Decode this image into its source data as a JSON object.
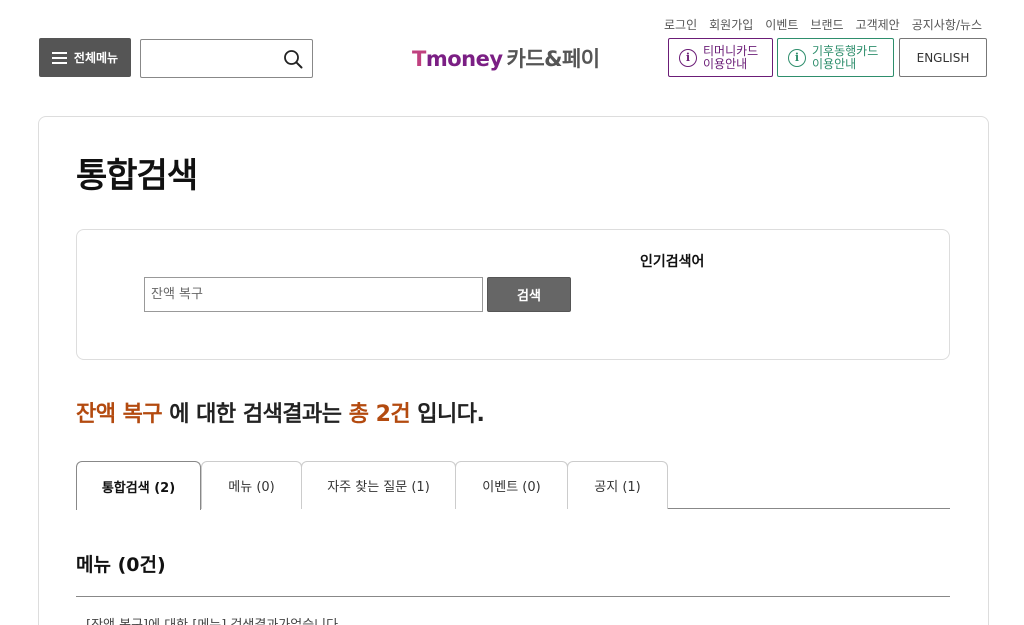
{
  "util_nav": [
    "로그인",
    "회원가입",
    "이벤트",
    "브랜드",
    "고객제안",
    "공지사항/뉴스"
  ],
  "header": {
    "menu_label": "전체메뉴",
    "search_placeholder": "",
    "logo_brand": "money",
    "logo_brand_t": "T",
    "logo_suffix": "카드&페이",
    "guide_tmoney_line1": "티머니카드",
    "guide_tmoney_line2": "이용안내",
    "guide_climate_line1": "기후동행카드",
    "guide_climate_line2": "이용안내",
    "english_label": "ENGLISH"
  },
  "page": {
    "title": "통합검색",
    "search_value": "",
    "search_placeholder": "잔액 복구",
    "search_button": "검색",
    "popular_title": "인기검색어"
  },
  "result": {
    "keyword": "잔액 복구",
    "middle_text": " 에 대한 검색결과는 ",
    "count_text": "총 2건",
    "end_text": " 입니다."
  },
  "tabs": [
    {
      "label": "통합검색 (2)",
      "active": true
    },
    {
      "label": "메뉴 (0)",
      "active": false
    },
    {
      "label": "자주 찾는 질문 (1)",
      "active": false
    },
    {
      "label": "이벤트 (0)",
      "active": false
    },
    {
      "label": "공지 (1)",
      "active": false
    }
  ],
  "menu_section": {
    "title": "메뉴 (0건)",
    "empty_message": "[잔액 복구]에 대한 [메뉴] 검색결과가없습니다"
  },
  "colors": {
    "tmoney_purple": "#6b1d77",
    "climate_green": "#2e8e6c",
    "highlight_orange": "#b34a0f",
    "menu_button_bg": "#555555"
  }
}
